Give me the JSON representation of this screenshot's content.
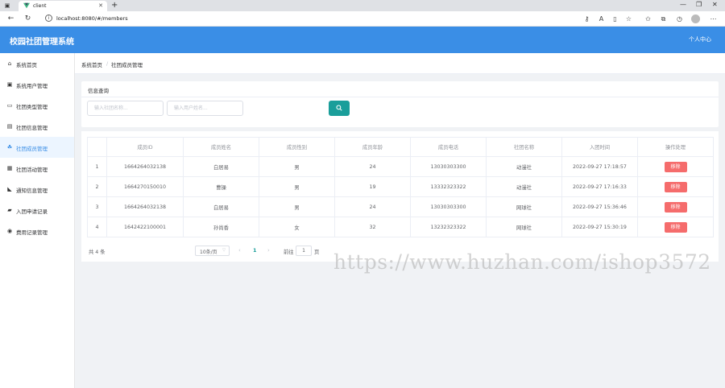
{
  "browser": {
    "tab_title": "client",
    "tab_close": "✕",
    "new_tab": "+",
    "url": "localhost:8080/#/members",
    "colors": {
      "favicon": "#41b883"
    }
  },
  "header": {
    "app_title": "校园社团管理系统",
    "user_menu": "个人中心",
    "colors": {
      "background": "#3a8ee6"
    }
  },
  "sidebar": {
    "items": [
      {
        "label": "系统首页",
        "icon": "home-icon",
        "active": false
      },
      {
        "label": "系统用户管理",
        "icon": "user-admin-icon",
        "active": false
      },
      {
        "label": "社团类型管理",
        "icon": "category-icon",
        "active": false
      },
      {
        "label": "社团信息管理",
        "icon": "club-info-icon",
        "active": false
      },
      {
        "label": "社团成员管理",
        "icon": "members-icon",
        "active": true
      },
      {
        "label": "社团活动管理",
        "icon": "activity-icon",
        "active": false
      },
      {
        "label": "通知信息管理",
        "icon": "notice-icon",
        "active": false
      },
      {
        "label": "入团申请记录",
        "icon": "application-icon",
        "active": false
      },
      {
        "label": "费用记录管理",
        "icon": "fee-icon",
        "active": false
      }
    ]
  },
  "breadcrumb": {
    "home": "系统首页",
    "separator": "/",
    "current": "社团成员管理"
  },
  "query": {
    "title": "信息查询",
    "club_name_placeholder": "输入社团名称...",
    "user_name_placeholder": "输入用户姓名...",
    "search_icon": "search-icon"
  },
  "table": {
    "headers": [
      "",
      "成员ID",
      "成员姓名",
      "成员性别",
      "成员年龄",
      "成员电话",
      "社团名称",
      "入团时间",
      "操作处理"
    ],
    "rows": [
      [
        "1",
        "1664264032138",
        "白居易",
        "男",
        "24",
        "13030303300",
        "动漫社",
        "2022-09-27 17:18:57"
      ],
      [
        "2",
        "1664270150010",
        "曹操",
        "男",
        "19",
        "13332323322",
        "动漫社",
        "2022-09-27 17:16:33"
      ],
      [
        "3",
        "1664264032138",
        "白居易",
        "男",
        "24",
        "13030303300",
        "网球社",
        "2022-09-27 15:36:46"
      ],
      [
        "4",
        "1642422100001",
        "孙尚香",
        "女",
        "32",
        "13232323322",
        "网球社",
        "2022-09-27 15:30:19"
      ]
    ],
    "action_label": "移除",
    "colors": {
      "action": "#f56c6c"
    }
  },
  "pagination": {
    "total": "共 4 条",
    "page_size": "10条/页",
    "current_page": "1",
    "goto_label": "前往",
    "goto_value": "1",
    "page_unit": "页",
    "prev": "‹",
    "next": "›",
    "colors": {
      "accent": "#1a9e9a"
    }
  },
  "watermark": "https://www.huzhan.com/ishop3572"
}
